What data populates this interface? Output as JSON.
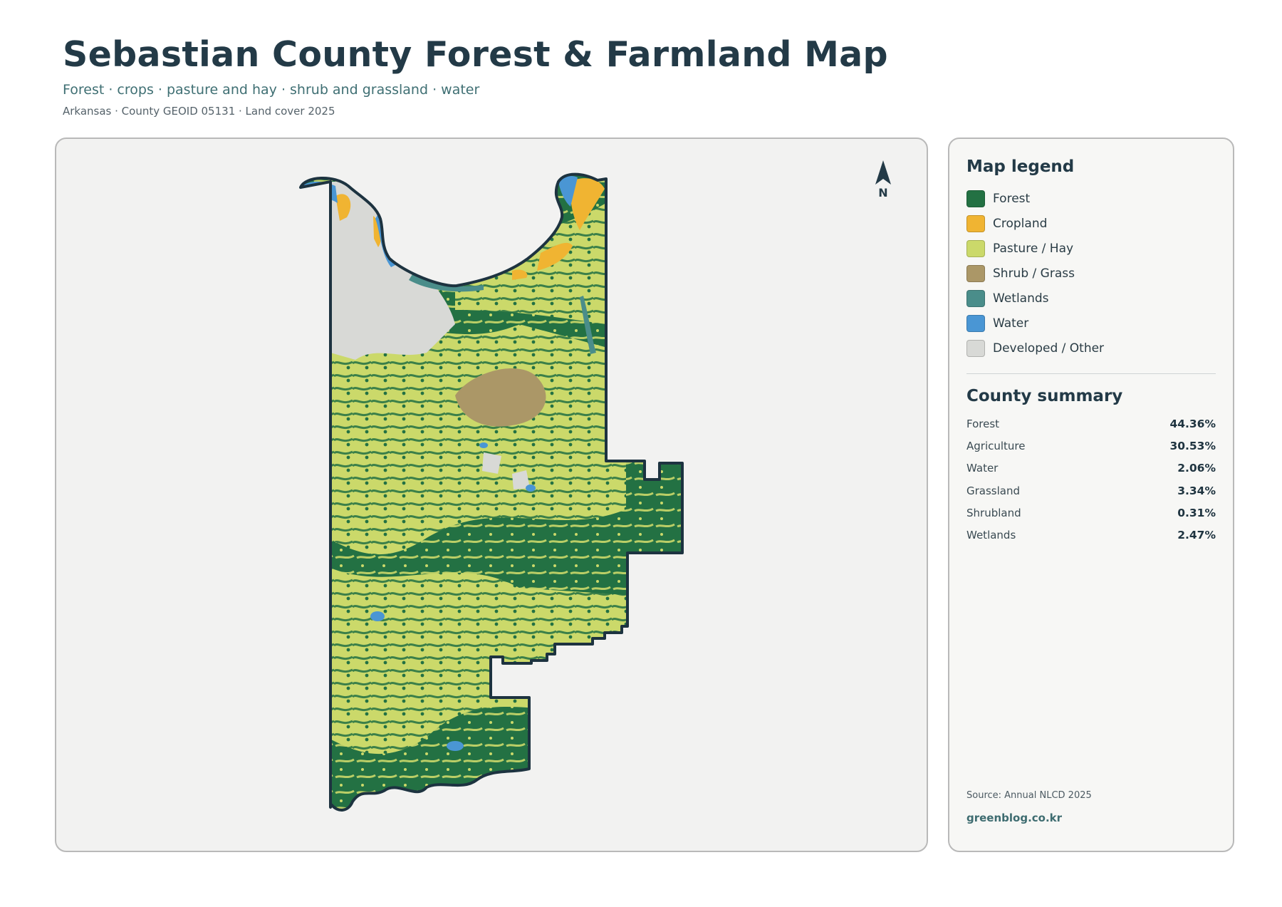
{
  "header": {
    "title": "Sebastian County Forest & Farmland Map",
    "subtitle": "Forest · crops · pasture and hay · shrub and grassland · water",
    "meta": "Arkansas · County GEOID 05131 · Land cover 2025"
  },
  "map": {
    "north_label": "N",
    "north_icon": "north-arrow-icon",
    "colors": {
      "forest": "#237143",
      "cropland": "#f0b432",
      "pasture": "#cbd96a",
      "shrub": "#ab9767",
      "wetlands": "#4a8d8a",
      "water": "#4a96d4",
      "developed": "#d8d9d6",
      "boundary": "#1d3340"
    }
  },
  "legend": {
    "title": "Map legend",
    "items": [
      {
        "label": "Forest",
        "color": "#237143"
      },
      {
        "label": "Cropland",
        "color": "#f0b432"
      },
      {
        "label": "Pasture / Hay",
        "color": "#cbd96a"
      },
      {
        "label": "Shrub / Grass",
        "color": "#ab9767"
      },
      {
        "label": "Wetlands",
        "color": "#4a8d8a"
      },
      {
        "label": "Water",
        "color": "#4a96d4"
      },
      {
        "label": "Developed / Other",
        "color": "#d8d9d6"
      }
    ]
  },
  "summary": {
    "title": "County summary",
    "rows": [
      {
        "label": "Forest",
        "value": "44.36%"
      },
      {
        "label": "Agriculture",
        "value": "30.53%"
      },
      {
        "label": "Water",
        "value": "2.06%"
      },
      {
        "label": "Grassland",
        "value": "3.34%"
      },
      {
        "label": "Shrubland",
        "value": "0.31%"
      },
      {
        "label": "Wetlands",
        "value": "2.47%"
      }
    ]
  },
  "footer": {
    "source": "Source: Annual NLCD 2025",
    "site": "greenblog.co.kr"
  }
}
